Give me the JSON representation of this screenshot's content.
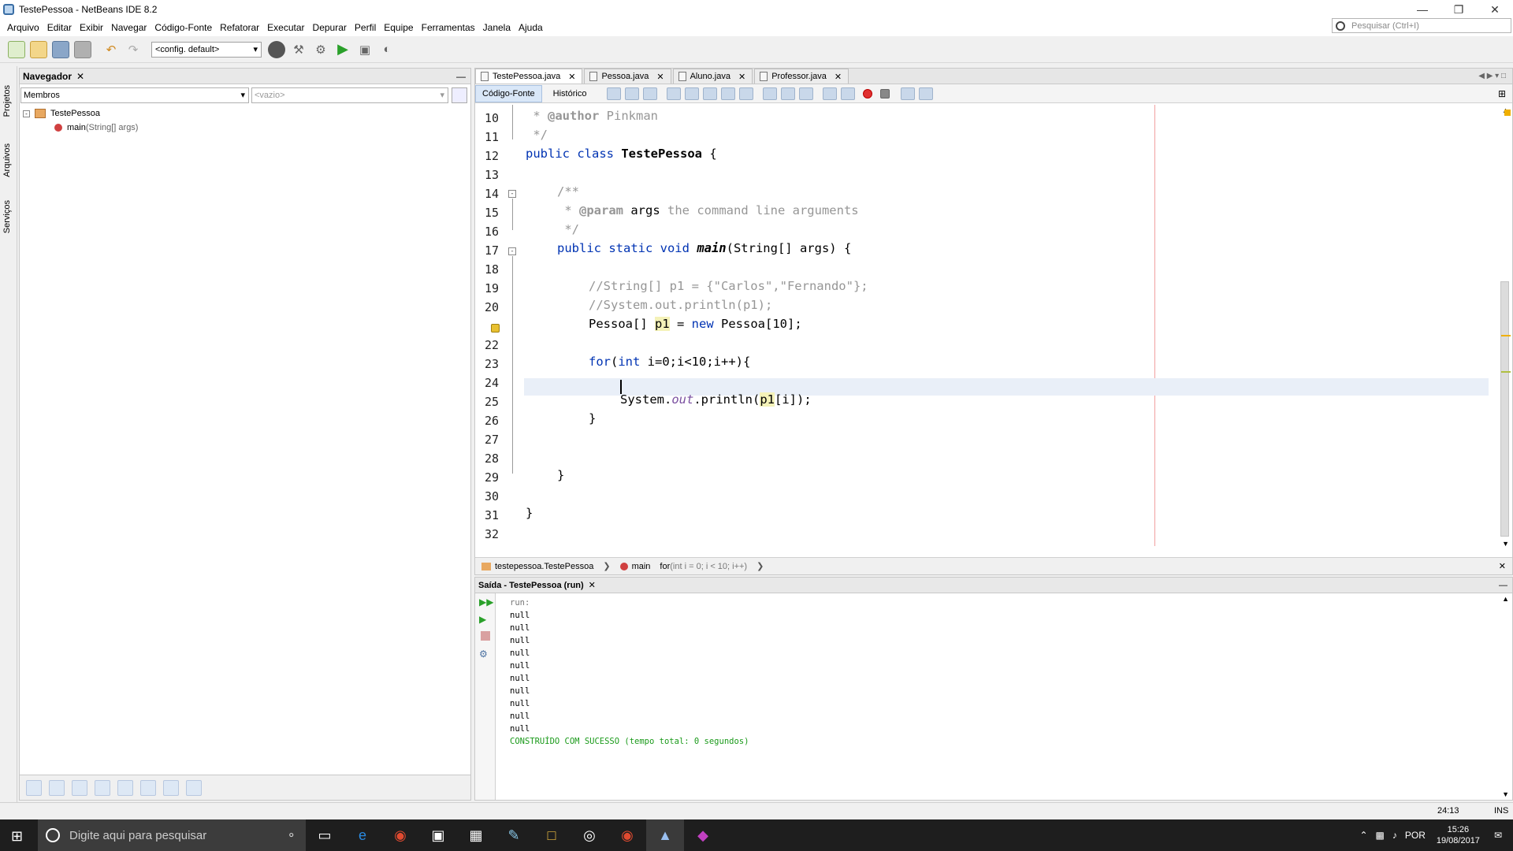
{
  "window": {
    "title": "TestePessoa - NetBeans IDE 8.2"
  },
  "menu": [
    "Arquivo",
    "Editar",
    "Exibir",
    "Navegar",
    "Código-Fonte",
    "Refatorar",
    "Executar",
    "Depurar",
    "Perfil",
    "Equipe",
    "Ferramentas",
    "Janela",
    "Ajuda"
  ],
  "search": {
    "placeholder": "Pesquisar (Ctrl+I)"
  },
  "toolbar": {
    "config": "<config. default>"
  },
  "sidebar_tabs": [
    "Projetos",
    "Arquivos",
    "Serviços"
  ],
  "navigator": {
    "title": "Navegador",
    "filter": "Membros",
    "filter2": "<vazio>",
    "tree": {
      "class": "TestePessoa",
      "method": "main",
      "method_args": "(String[] args)"
    }
  },
  "editor": {
    "tabs": [
      "TestePessoa.java",
      "Pessoa.java",
      "Aluno.java",
      "Professor.java"
    ],
    "mode_tabs": [
      "Código-Fonte",
      "Histórico"
    ],
    "line_numbers": [
      "10",
      "11",
      "12",
      "13",
      "14",
      "15",
      "16",
      "17",
      "18",
      "19",
      "20",
      "",
      "22",
      "23",
      "24",
      "25",
      "26",
      "27",
      "28",
      "29",
      "30",
      "31",
      "32"
    ],
    "code": {
      "l10a": " * ",
      "l10b": "@author",
      "l10c": " Pinkman",
      "l11": " */",
      "l12a": "public class ",
      "l12b": "TestePessoa",
      "l12c": " {",
      "l14": "/**",
      "l15a": " * ",
      "l15b": "@param",
      "l15c": " args",
      "l15d": " the command line arguments",
      "l16": " */",
      "l17a": "public static void ",
      "l17b": "main",
      "l17c": "(String[] args) {",
      "l19": "//String[] p1 = {\"Carlos\",\"Fernando\"};",
      "l20": "//System.out.println(p1);",
      "l21a": "Pessoa[] ",
      "l21b": "p1",
      "l21c": " = ",
      "l21d": "new",
      "l21e": " Pessoa[10];",
      "l23a": "for",
      "l23b": "(",
      "l23c": "int",
      "l23d": " i=0;i<10;i++){",
      "l25a": "System.",
      "l25b": "out",
      "l25c": ".println(",
      "l25d": "p1",
      "l25e": "[i]);",
      "l26": "}",
      "l29": "}",
      "l31": "}"
    },
    "breadcrumb": {
      "c1": "testepessoa.TestePessoa",
      "c2": "main",
      "c3a": "for",
      "c3b": " (int i = 0; i < 10; i++)"
    }
  },
  "output": {
    "title": "Saída - TestePessoa (run)",
    "run": "run:",
    "lines": [
      "null",
      "null",
      "null",
      "null",
      "null",
      "null",
      "null",
      "null",
      "null",
      "null"
    ],
    "result": "CONSTRUÍDO COM SUCESSO (tempo total: 0 segundos)"
  },
  "status": {
    "position": "24:13",
    "mode": "INS"
  },
  "taskbar": {
    "search": "Digite aqui para pesquisar",
    "lang": "POR",
    "time": "15:26",
    "date": "19/08/2017"
  },
  "colors": {
    "keyword": "#0033b3",
    "comment": "#969696",
    "success": "#1a9a1a",
    "highlight": "#f4f2b8"
  }
}
